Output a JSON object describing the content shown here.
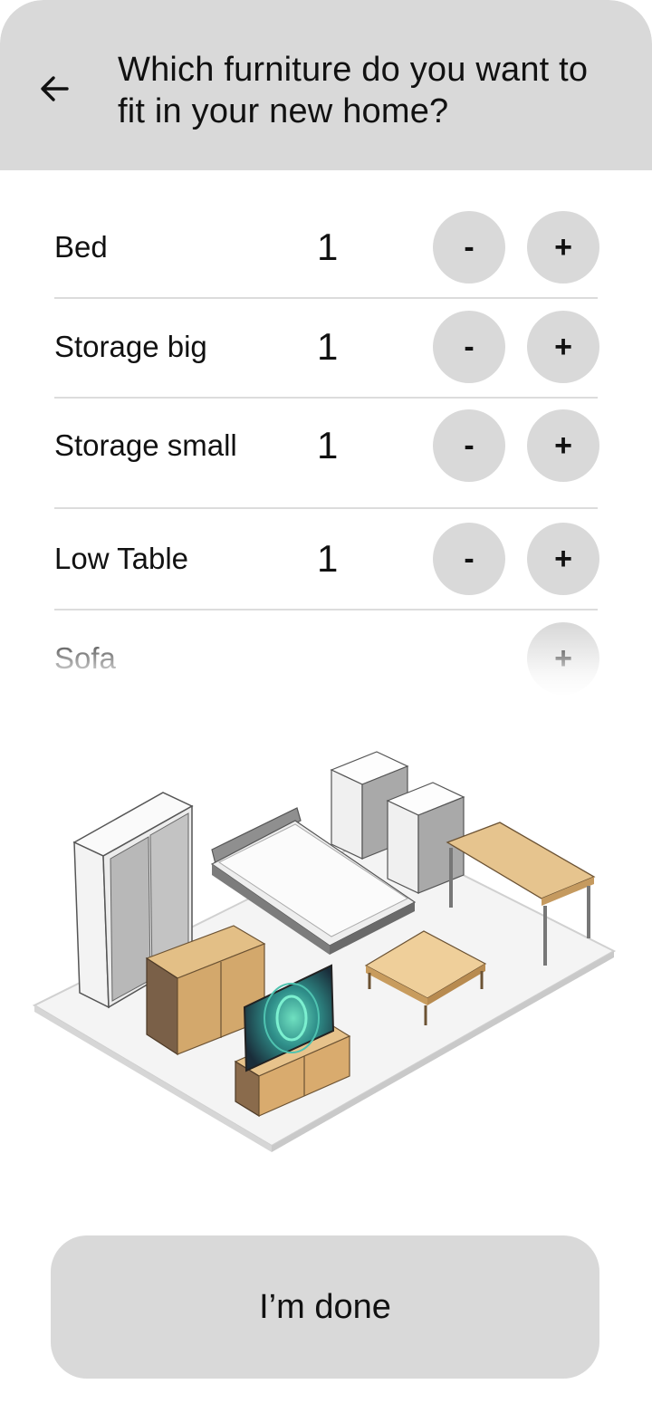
{
  "header": {
    "title": "Which furniture do you want to fit in your new home?"
  },
  "items": [
    {
      "label": "Bed",
      "count": "1",
      "minus": "-",
      "plus": "+"
    },
    {
      "label": "Storage big",
      "count": "1",
      "minus": "-",
      "plus": "+"
    },
    {
      "label": "Storage small",
      "count": "1",
      "minus": "-",
      "plus": "+"
    },
    {
      "label": "Low Table",
      "count": "1",
      "minus": "-",
      "plus": "+"
    },
    {
      "label": "Sofa",
      "plus": "+"
    }
  ],
  "footer": {
    "done_label": "I’m done"
  },
  "colors": {
    "header_bg": "#d9d9d9",
    "button_bg": "#d9d9d9",
    "divider": "#dcdcdc"
  },
  "icons": {
    "back": "arrow-left-icon"
  }
}
